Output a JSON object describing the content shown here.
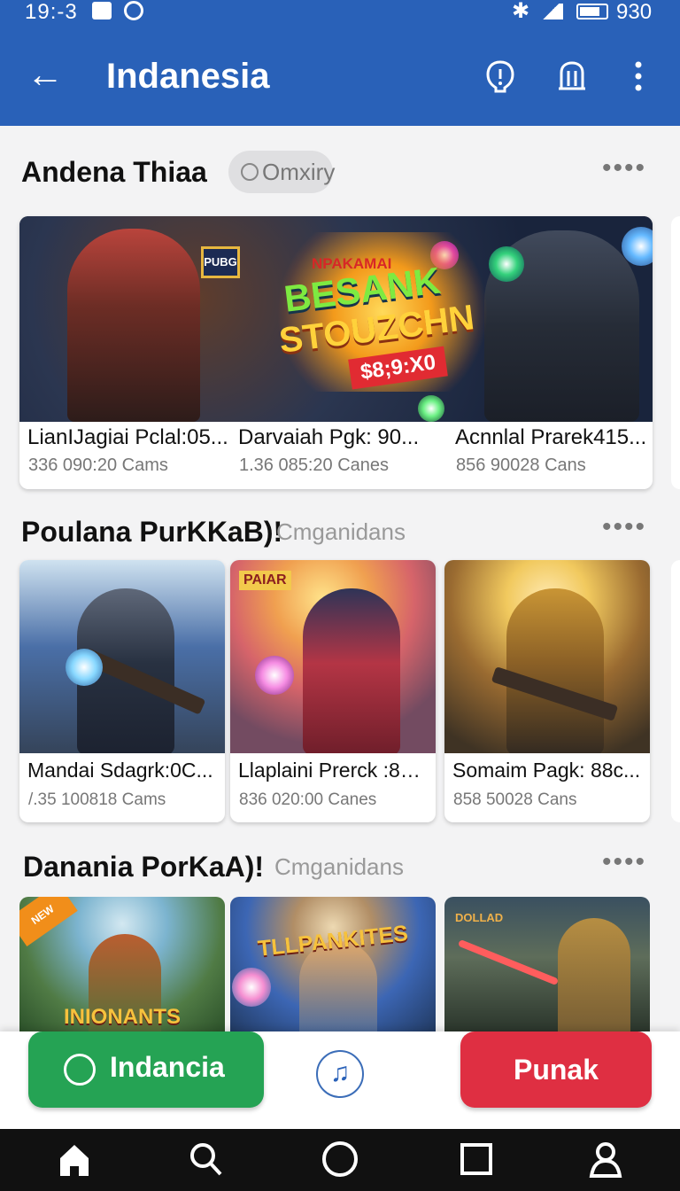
{
  "status_bar": {
    "time": "19:-3",
    "level": "930"
  },
  "app_bar": {
    "title": "Indanesia",
    "icons": [
      "back-arrow-icon",
      "alert-icon",
      "store-icon",
      "more-vert-icon"
    ]
  },
  "sections": [
    {
      "title": "Andena Thiaa",
      "chip": "Omxiry",
      "banner": {
        "topline": "NPAKAMAI",
        "headline": [
          "BESANK",
          "STOUZCHN"
        ],
        "price": "$8;9:X0",
        "captions": [
          {
            "title": "LianIJagiai Pclal:05...",
            "meta": "336 090:20 Cams"
          },
          {
            "title": "Darvaiah Pgk: 90...",
            "meta": "1.36 085:20 Canes"
          },
          {
            "title": "Acnnlal Prarek415...",
            "meta": "856  90028 Cans"
          }
        ],
        "logo": "PUBG"
      }
    },
    {
      "title": "Poulana PurKKaB)!",
      "subtitle": "Cmganidans",
      "cards": [
        {
          "title": "Mandai Sdagrk:0C...",
          "meta": "/.35 100818 Cams",
          "art": "soldier-city"
        },
        {
          "title": "Llaplaini Prerck :80...",
          "meta": "836 020:00 Canes",
          "art": "heroine-explosion"
        },
        {
          "title": "Somaim Pagk: 88c...",
          "meta": "858  50028 Cans",
          "art": "golden-knight"
        }
      ],
      "first_card_label": "PAIAR"
    },
    {
      "title": "Danania PorKaA)!",
      "subtitle": "Cmganidans",
      "cards": [
        {
          "label": "INIONANTS",
          "art": "fantasy-group",
          "badge": "NEW"
        },
        {
          "label": "TLLPANKITES",
          "art": "champion"
        },
        {
          "label": "DOLLAD",
          "art": "gold-warrior"
        }
      ]
    }
  ],
  "actions": {
    "primary": "Indancia",
    "secondary": "Punak",
    "middle_icon": "music-icon"
  },
  "nav": [
    "home-icon",
    "search-icon",
    "circle-icon",
    "square-icon",
    "profile-icon"
  ],
  "colors": {
    "brand": "#2961b8",
    "green": "#25a354",
    "red": "#df2f42"
  }
}
